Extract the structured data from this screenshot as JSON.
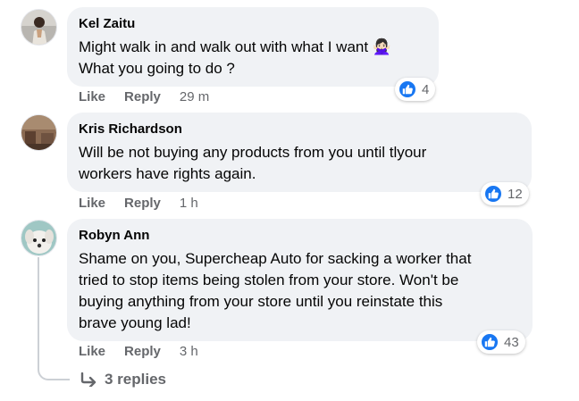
{
  "comments": [
    {
      "author": "Kel Zaitu",
      "text_lines": [
        "Might walk in and walk out with what I want 🙅🏻‍♀️",
        "What you going to do ?"
      ],
      "actions": {
        "like": "Like",
        "reply": "Reply",
        "time": "29 m"
      },
      "reaction_count": "4",
      "avatar_icon": "profile-photo-woman"
    },
    {
      "author": "Kris Richardson",
      "text_lines": [
        "Will be not buying any products from you until tlyour",
        "workers have rights again."
      ],
      "actions": {
        "like": "Like",
        "reply": "Reply",
        "time": "1 h"
      },
      "reaction_count": "12",
      "avatar_icon": "profile-photo-room"
    },
    {
      "author": "Robyn Ann",
      "text_lines": [
        "Shame on you, Supercheap Auto for sacking a worker that",
        "tried to stop items being stolen from your store. Won't be",
        "buying anything from your store until you reinstate this",
        "brave young lad!"
      ],
      "actions": {
        "like": "Like",
        "reply": "Reply",
        "time": "3 h"
      },
      "reaction_count": "43",
      "avatar_icon": "profile-photo-dog"
    }
  ],
  "replies_link": "3 replies",
  "colors": {
    "bubble": "#f0f2f5",
    "like_blue": "#1877f2",
    "muted": "#65676b"
  }
}
